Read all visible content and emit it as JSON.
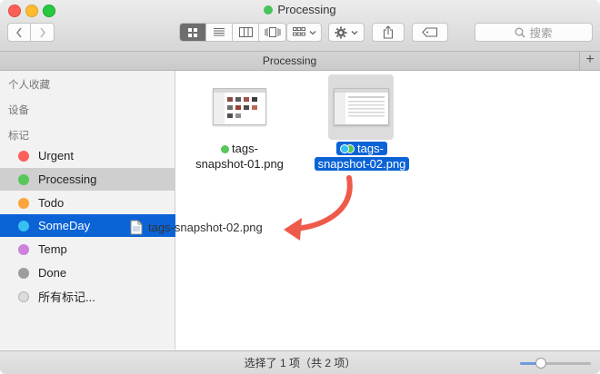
{
  "window": {
    "title": "Processing",
    "title_tag_color": "#46c35a"
  },
  "toolbar": {
    "back_icon": "chevron-left-icon",
    "forward_icon": "chevron-right-icon",
    "view_modes": [
      "icon-view",
      "list-view",
      "column-view",
      "cover-flow-view"
    ],
    "active_view": "icon-view",
    "arrange_icon": "arrange-grid-icon",
    "action_icon": "gear-icon",
    "share_icon": "share-icon",
    "tag_icon": "tag-icon",
    "search_placeholder": "搜索"
  },
  "tab": {
    "label": "Processing",
    "add_label": "+"
  },
  "sidebar": {
    "sections": [
      "个人收藏",
      "设备",
      "标记"
    ],
    "tags": [
      {
        "label": "Urgent",
        "color": "#fc605c"
      },
      {
        "label": "Processing",
        "color": "#56c759"
      },
      {
        "label": "Todo",
        "color": "#fda43b"
      },
      {
        "label": "SomeDay",
        "color": "#36c1f2"
      },
      {
        "label": "Temp",
        "color": "#cd80dd"
      },
      {
        "label": "Done",
        "color": "#9d9d9d"
      },
      {
        "label": "所有标记...",
        "color": "#dcdcdc"
      }
    ],
    "highlighted_tag": "Processing",
    "drop_target_tag": "SomeDay"
  },
  "files": [
    {
      "line1": "tags-",
      "line2": "snapshot-01.png",
      "tag_colors": [
        "#56c759"
      ],
      "selected": false
    },
    {
      "line1": "tags-",
      "line2": "snapshot-02.png",
      "tag_colors": [
        "#36c1f2",
        "#56c759"
      ],
      "selected": true
    }
  ],
  "drag": {
    "filename": "tags-snapshot-02.png",
    "arrow_color": "#ee5a4a"
  },
  "status": {
    "text": "选择了 1 项（共 2 项）",
    "zoom": 0.3
  }
}
